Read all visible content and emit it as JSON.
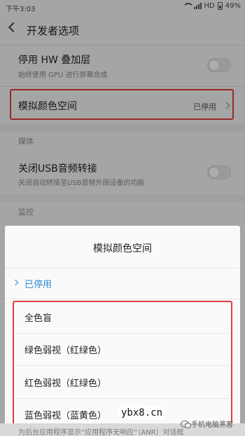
{
  "status": {
    "time": "下午3:03",
    "network": "HD",
    "battery": "49%"
  },
  "header": {
    "title": "开发者选项"
  },
  "settings": {
    "hw_overlay": {
      "title": "停用 HW 叠加层",
      "subtitle": "始终使用 GPU 进行屏幕合成"
    },
    "color_space": {
      "title": "模拟颜色空间",
      "value": "已停用"
    },
    "media_section": "媒体",
    "usb_audio": {
      "title": "关闭USB音频转接",
      "subtitle": "关闭自动转接至USB音频外围设备的功能"
    },
    "monitor_section": "监控"
  },
  "sheet": {
    "title": "模拟颜色空间",
    "selected": "已停用",
    "options": [
      "全色盲",
      "绿色弱视（红绿色）",
      "红色弱视（红绿色）",
      "蓝色弱视（蓝黄色）"
    ]
  },
  "bottom_text": "为后台应用程序显示“应用程序无响应”（ANR）对话框",
  "watermarks": {
    "site": "ybx8.cn",
    "brand": "手机电脑黑客"
  },
  "colors": {
    "accent": "#2a8bd6",
    "highlight": "#e23b3b"
  }
}
